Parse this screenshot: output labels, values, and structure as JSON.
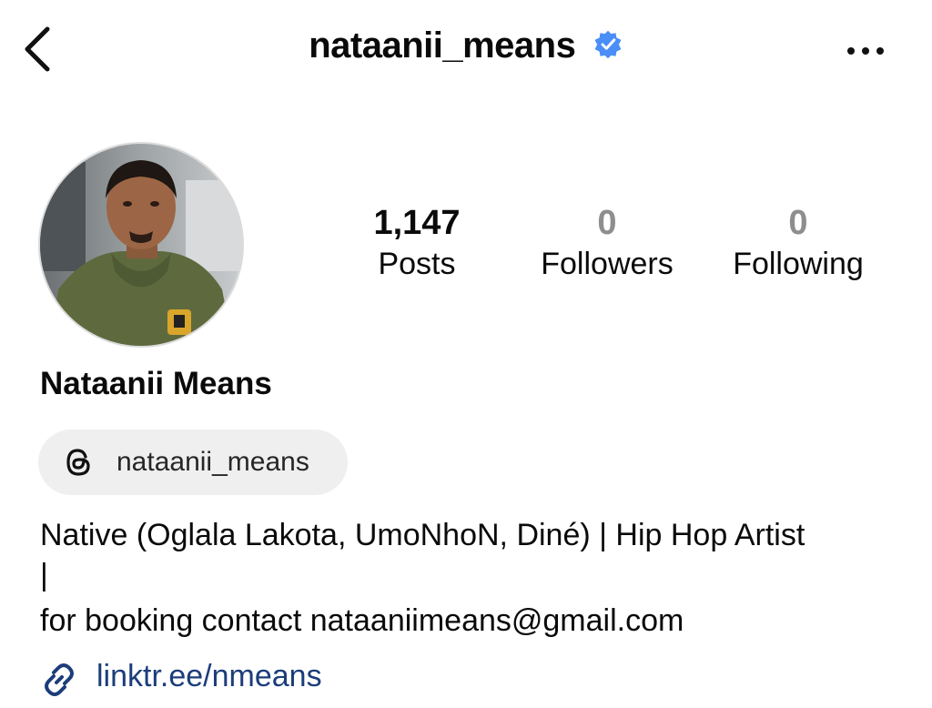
{
  "header": {
    "username": "nataanii_means",
    "verified_color": "#4a8ff7"
  },
  "profile": {
    "full_name": "Nataanii Means"
  },
  "stats": [
    {
      "value": "1,147",
      "label": "Posts"
    },
    {
      "value": "0",
      "label": "Followers"
    },
    {
      "value": "0",
      "label": "Following"
    }
  ],
  "threads": {
    "handle": "nataanii_means",
    "icon": "threads-icon"
  },
  "bio": {
    "line1": "Native (Oglala Lakota, UmoNhoN, Diné) | Hip Hop Artist",
    "line2": "|",
    "line3": "for booking contact nataaniimeans@gmail.com"
  },
  "link": {
    "text": "linktr.ee/nmeans",
    "icon": "link-icon",
    "color": "#1c3d7a"
  }
}
